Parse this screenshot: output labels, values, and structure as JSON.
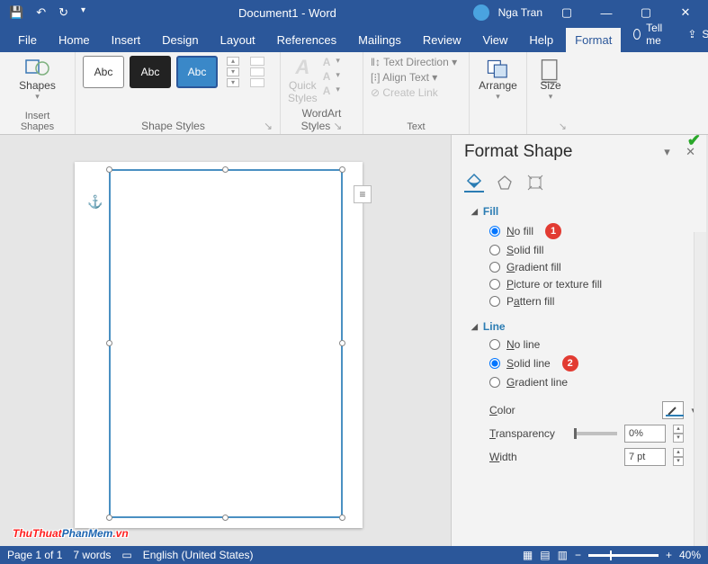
{
  "title": "Document1 - Word",
  "user": "Nga Tran",
  "menu_tabs": {
    "file": "File",
    "home": "Home",
    "insert": "Insert",
    "design": "Design",
    "layout": "Layout",
    "references": "References",
    "mailings": "Mailings",
    "review": "Review",
    "view": "View",
    "help": "Help",
    "format": "Format",
    "tell": "Tell me",
    "share": "Share"
  },
  "ribbon": {
    "shapes": "Shapes",
    "insert_shapes": "Insert Shapes",
    "shape_styles": "Shape Styles",
    "abc": "Abc",
    "wordart": "WordArt Styles",
    "quick_styles": "Quick\nStyles",
    "text": "Text",
    "text_dir": "Text Direction",
    "align_text": "Align Text",
    "create_link": "Create Link",
    "arrange": "Arrange",
    "size": "Size"
  },
  "pane": {
    "title": "Format Shape",
    "sect_fill": "Fill",
    "sect_line": "Line",
    "fill": {
      "no": "No fill",
      "solid": "Solid fill",
      "grad": "Gradient fill",
      "pic": "Picture or texture fill",
      "patt": "Pattern fill",
      "selected": "no"
    },
    "line": {
      "no": "No line",
      "solid": "Solid line",
      "grad": "Gradient line",
      "selected": "solid"
    },
    "badge1": "1",
    "badge2": "2",
    "color_lbl": "Color",
    "transp_lbl": "Transparency",
    "transp_val": "0%",
    "width_lbl": "Width",
    "width_val": "7 pt"
  },
  "status": {
    "pages": "Page 1 of 1",
    "words": "7 words",
    "lang": "English (United States)",
    "zoom": "40%"
  },
  "watermark": {
    "a": "ThuThuat",
    "b": "PhanMem",
    "c": ".vn"
  }
}
